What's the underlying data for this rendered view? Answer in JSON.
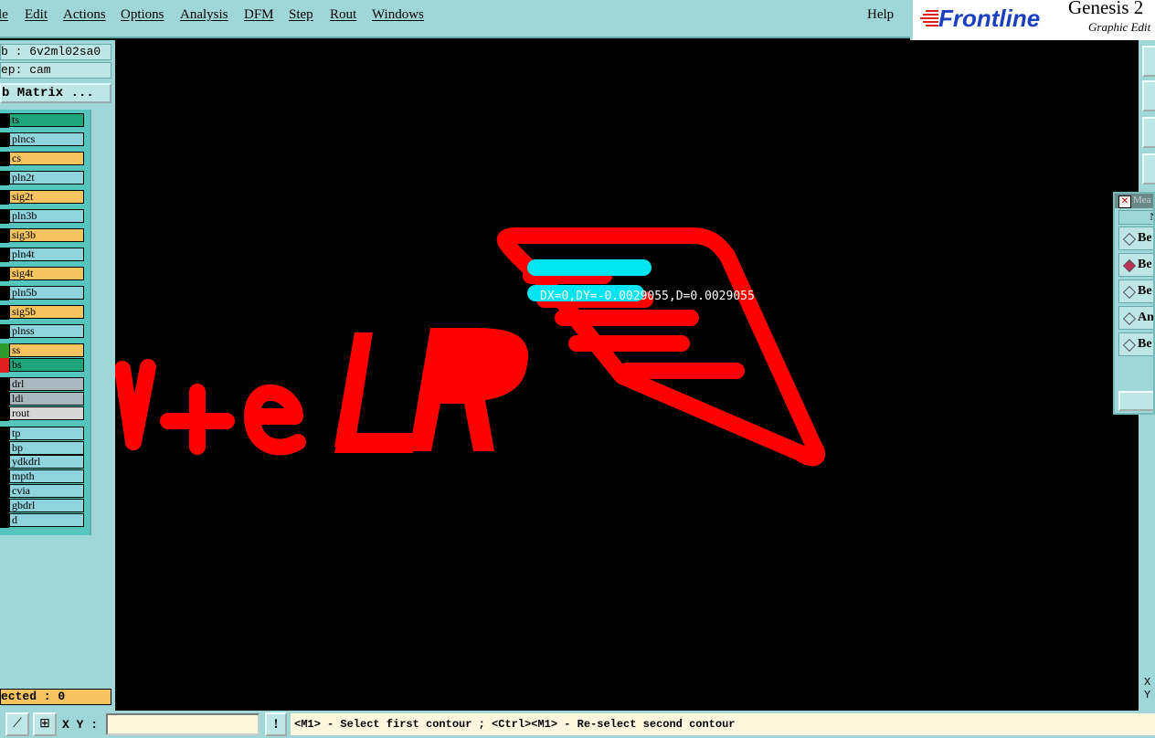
{
  "menu": {
    "items": [
      "le",
      "Edit",
      "Actions",
      "Options",
      "Analysis",
      "DFM",
      "Step",
      "Rout",
      "Windows"
    ],
    "help": "Help"
  },
  "brand": {
    "logo_text": "Frontline",
    "title": "Genesis 2",
    "subtitle": "Graphic Edit"
  },
  "job": {
    "job_line": "b : 6v2ml02sa0",
    "step_line": "ep: cam",
    "matrix_button": "b Matrix ..."
  },
  "layers": [
    {
      "name": "ts",
      "color": "#1fa57a"
    },
    {
      "name": "plncs",
      "color": "#8fd3dc"
    },
    {
      "name": "cs",
      "color": "#f5c45e"
    },
    {
      "name": "pln2t",
      "color": "#8fd3dc"
    },
    {
      "name": "sig2t",
      "color": "#f5c45e"
    },
    {
      "name": "pln3b",
      "color": "#8fd3dc"
    },
    {
      "name": "sig3b",
      "color": "#f5c45e"
    },
    {
      "name": "pln4t",
      "color": "#8fd3dc"
    },
    {
      "name": "sig4t",
      "color": "#f5c45e"
    },
    {
      "name": "pln5b",
      "color": "#8fd3dc"
    },
    {
      "name": "sig5b",
      "color": "#f5c45e"
    },
    {
      "name": "plnss",
      "color": "#8fd3dc"
    },
    {
      "name": "ss",
      "color": "#f5c45e",
      "marker": "#2f9a2f"
    },
    {
      "name": "bs",
      "color": "#1fa57a",
      "marker": "#e02020",
      "flag": "⊞"
    },
    {
      "name": "drl",
      "color": "#a9b8bf"
    },
    {
      "name": "ldi",
      "color": "#a9b8bf"
    },
    {
      "name": "rout",
      "color": "#d7d7d7"
    },
    {
      "name": "tp",
      "color": "#8fd3dc"
    },
    {
      "name": "bp",
      "color": "#8fd3dc"
    },
    {
      "name": "ydkdrl",
      "color": "#8fd3dc"
    },
    {
      "name": "mpth",
      "color": "#8fd3dc"
    },
    {
      "name": "cvia",
      "color": "#8fd3dc"
    },
    {
      "name": "gbdrl",
      "color": "#8fd3dc"
    },
    {
      "name": "d",
      "color": "#8fd3dc"
    }
  ],
  "selected": "ected : 0",
  "canvas": {
    "measure_text": "DX=0,DY=-0.0029055,D=0.0029055",
    "artwork_text": "LR",
    "feature_color": "#ff0000",
    "highlight_color": "#00e5ef"
  },
  "measure_popup": {
    "header": "N",
    "options": [
      {
        "label": "Be",
        "selected": false
      },
      {
        "label": "Be",
        "selected": true
      },
      {
        "label": "Be",
        "selected": false
      },
      {
        "label": "An",
        "selected": false
      },
      {
        "label": "Be",
        "selected": false
      }
    ]
  },
  "right_toolbar": {
    "x_label": "X",
    "y_label": "Y"
  },
  "status": {
    "xy_label": "X Y :",
    "xy_value": "",
    "warn_label": "!",
    "message": "<M1> - Select first contour ; <Ctrl><M1> - Re-select second contour"
  }
}
